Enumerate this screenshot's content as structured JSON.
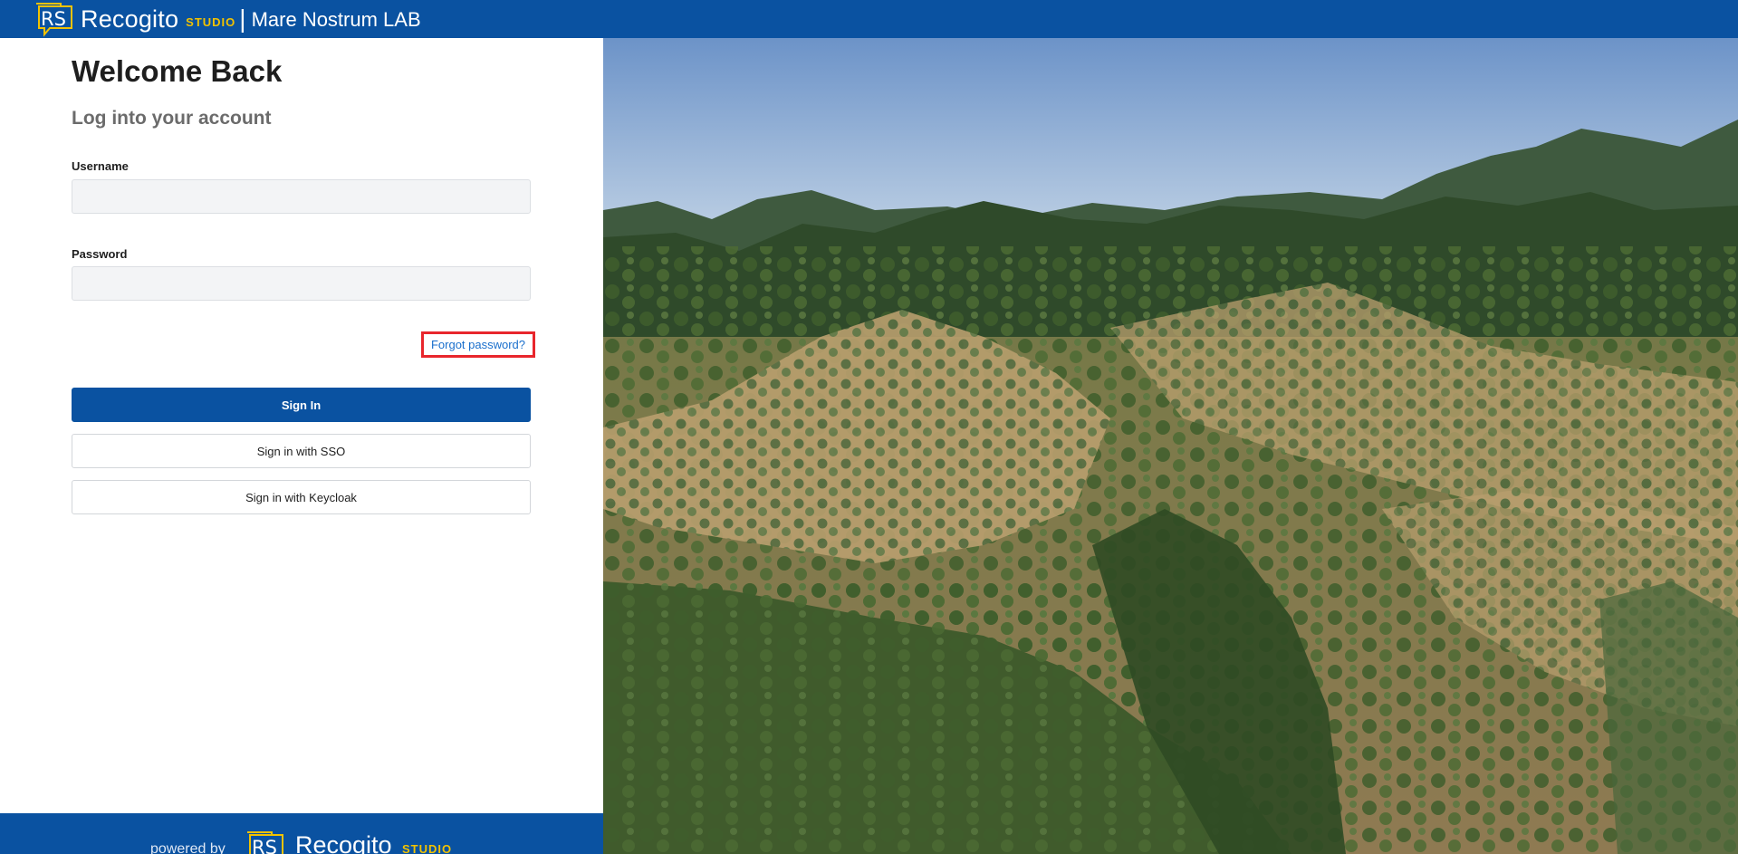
{
  "topbar": {
    "logo_text": "RS",
    "brand_name": "Recogito",
    "brand_studio": "STUDIO",
    "separator": "|",
    "project_name": "Mare Nostrum LAB"
  },
  "login": {
    "title": "Welcome Back",
    "subtitle": "Log into your account",
    "username_label": "Username",
    "username_value": "",
    "password_label": "Password",
    "password_value": "",
    "forgot_password": "Forgot password?",
    "sign_in": "Sign In",
    "sign_in_sso": "Sign in with SSO",
    "sign_in_keycloak": "Sign in with Keycloak"
  },
  "footer": {
    "powered_by": "powered by",
    "logo_text": "RS",
    "brand_name": "Recogito",
    "brand_studio": "STUDIO"
  },
  "colors": {
    "brand_blue": "#0a52a1",
    "studio_yellow": "#f2c200",
    "highlight_red": "#e8262c",
    "link_blue": "#1a6fcc"
  },
  "icons": {
    "logo": "recogito-studio-logo-icon"
  }
}
